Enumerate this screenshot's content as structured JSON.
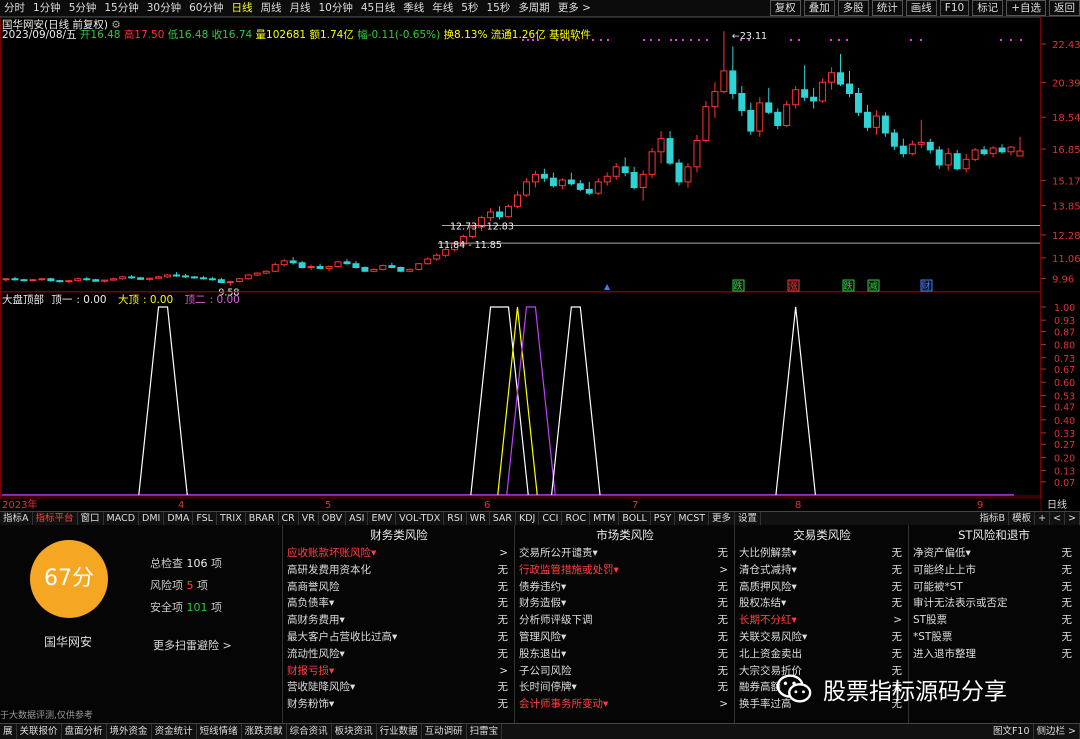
{
  "toolbar": {
    "periods": [
      "分时",
      "1分钟",
      "5分钟",
      "15分钟",
      "30分钟",
      "60分钟",
      "日线",
      "周线",
      "月线",
      "10分钟",
      "45日线",
      "季线",
      "年线",
      "5秒",
      "15秒",
      "多周期",
      "更多 >"
    ],
    "active_period": "日线",
    "right_tools": [
      "复权",
      "叠加",
      "多股",
      "统计",
      "画线",
      "F10",
      "标记",
      "+自选",
      "返回"
    ]
  },
  "quote": {
    "title": "国华网安(日线 前复权)",
    "date": "2023/09/08/五",
    "open_label": "开16.48",
    "high_label": "高17.50",
    "low_label": "低16.48",
    "close_label": "收16.74",
    "volume_label": "量102681",
    "amount_label": "额1.74亿",
    "change_label": "幅-0.11(-0.65%)",
    "turnover_label": "换8.13%",
    "float_label": "流通1.26亿",
    "software_label": "基础软件"
  },
  "chart_data": [
    {
      "type": "candlestick",
      "y_ticks": [
        22.43,
        20.39,
        18.54,
        16.85,
        15.17,
        13.85,
        12.28,
        11.06,
        9.96
      ],
      "annotations": {
        "peak": "23.11",
        "trough": "9.58",
        "zone1": "12.73 - 12.83",
        "zone2": "11.84 - 11.85"
      },
      "x_ticks": [
        "2023年",
        "4",
        "5",
        "6",
        "7",
        "8",
        "9"
      ],
      "candles": [
        [
          9.9,
          10.0,
          9.8,
          9.95
        ],
        [
          9.95,
          10.05,
          9.85,
          9.9
        ],
        [
          9.9,
          9.95,
          9.8,
          9.85
        ],
        [
          9.85,
          9.95,
          9.8,
          9.9
        ],
        [
          9.9,
          10.0,
          9.85,
          9.95
        ],
        [
          9.95,
          10.0,
          9.8,
          9.85
        ],
        [
          9.85,
          9.9,
          9.75,
          9.8
        ],
        [
          9.8,
          9.9,
          9.7,
          9.85
        ],
        [
          9.85,
          10.0,
          9.8,
          9.95
        ],
        [
          9.95,
          10.05,
          9.85,
          9.9
        ],
        [
          9.9,
          9.95,
          9.8,
          9.82
        ],
        [
          9.82,
          9.9,
          9.75,
          9.88
        ],
        [
          9.88,
          10.0,
          9.85,
          9.95
        ],
        [
          9.95,
          10.1,
          9.9,
          10.05
        ],
        [
          10.05,
          10.15,
          9.95,
          10.0
        ],
        [
          10.0,
          10.05,
          9.9,
          9.92
        ],
        [
          9.92,
          10.0,
          9.85,
          9.98
        ],
        [
          9.98,
          10.1,
          9.95,
          10.05
        ],
        [
          10.05,
          10.2,
          10.0,
          10.15
        ],
        [
          10.15,
          10.3,
          10.05,
          10.1
        ],
        [
          10.1,
          10.2,
          10.0,
          10.05
        ],
        [
          10.05,
          10.1,
          9.95,
          10.0
        ],
        [
          10.0,
          10.1,
          9.9,
          9.95
        ],
        [
          9.95,
          10.05,
          9.85,
          9.9
        ],
        [
          9.9,
          10.0,
          9.7,
          9.75
        ],
        [
          9.75,
          9.85,
          9.58,
          9.8
        ],
        [
          9.8,
          10.0,
          9.75,
          9.95
        ],
        [
          9.95,
          10.2,
          9.9,
          10.15
        ],
        [
          10.15,
          10.3,
          10.1,
          10.25
        ],
        [
          10.25,
          10.4,
          10.2,
          10.35
        ],
        [
          10.35,
          10.8,
          10.3,
          10.7
        ],
        [
          10.7,
          11.0,
          10.6,
          10.9
        ],
        [
          10.9,
          11.1,
          10.7,
          10.8
        ],
        [
          10.8,
          10.9,
          10.5,
          10.55
        ],
        [
          10.55,
          10.7,
          10.4,
          10.6
        ],
        [
          10.6,
          10.75,
          10.45,
          10.5
        ],
        [
          10.5,
          10.65,
          10.35,
          10.6
        ],
        [
          10.6,
          10.9,
          10.55,
          10.85
        ],
        [
          10.85,
          11.0,
          10.7,
          10.75
        ],
        [
          10.75,
          10.9,
          10.5,
          10.55
        ],
        [
          10.55,
          10.6,
          10.3,
          10.35
        ],
        [
          10.35,
          10.5,
          10.3,
          10.45
        ],
        [
          10.45,
          10.7,
          10.4,
          10.65
        ],
        [
          10.65,
          10.8,
          10.5,
          10.55
        ],
        [
          10.55,
          10.6,
          10.3,
          10.35
        ],
        [
          10.35,
          10.5,
          10.3,
          10.45
        ],
        [
          10.45,
          10.8,
          10.4,
          10.75
        ],
        [
          10.75,
          11.1,
          10.7,
          11.0
        ],
        [
          11.0,
          11.3,
          10.9,
          11.2
        ],
        [
          11.2,
          11.6,
          11.1,
          11.5
        ],
        [
          11.5,
          11.9,
          11.4,
          11.8
        ],
        [
          11.8,
          12.3,
          11.7,
          12.2
        ],
        [
          12.2,
          12.8,
          12.1,
          12.7
        ],
        [
          12.7,
          13.3,
          12.5,
          13.2
        ],
        [
          13.2,
          13.7,
          13.0,
          13.5
        ],
        [
          13.5,
          13.8,
          13.1,
          13.25
        ],
        [
          13.25,
          13.9,
          13.2,
          13.8
        ],
        [
          13.8,
          14.6,
          13.7,
          14.4
        ],
        [
          14.4,
          15.3,
          14.3,
          15.1
        ],
        [
          15.1,
          15.7,
          14.8,
          15.5
        ],
        [
          15.5,
          15.8,
          15.1,
          15.3
        ],
        [
          15.3,
          15.6,
          14.8,
          14.9
        ],
        [
          14.9,
          15.3,
          14.7,
          15.2
        ],
        [
          15.2,
          15.6,
          14.9,
          15.0
        ],
        [
          15.0,
          15.2,
          14.6,
          14.7
        ],
        [
          14.7,
          15.1,
          14.4,
          14.5
        ],
        [
          14.5,
          15.3,
          14.4,
          15.1
        ],
        [
          15.1,
          15.6,
          14.9,
          15.4
        ],
        [
          15.4,
          16.1,
          15.2,
          15.9
        ],
        [
          15.9,
          16.4,
          15.4,
          15.6
        ],
        [
          15.6,
          15.9,
          14.7,
          14.8
        ],
        [
          14.8,
          15.7,
          14.1,
          15.5
        ],
        [
          15.5,
          16.9,
          15.3,
          16.7
        ],
        [
          16.7,
          17.8,
          16.1,
          17.4
        ],
        [
          17.4,
          17.8,
          16.0,
          16.1
        ],
        [
          16.1,
          16.3,
          14.9,
          15.1
        ],
        [
          15.1,
          16.1,
          14.8,
          15.9
        ],
        [
          15.9,
          17.6,
          15.6,
          17.3
        ],
        [
          17.3,
          19.4,
          17.2,
          19.1
        ],
        [
          19.1,
          20.4,
          18.5,
          19.9
        ],
        [
          19.9,
          23.11,
          19.8,
          21.0
        ],
        [
          21.0,
          22.3,
          19.5,
          19.8
        ],
        [
          19.8,
          20.2,
          18.6,
          18.9
        ],
        [
          18.9,
          19.3,
          17.6,
          17.8
        ],
        [
          17.8,
          19.6,
          17.5,
          19.3
        ],
        [
          19.3,
          20.1,
          18.7,
          18.8
        ],
        [
          18.8,
          19.0,
          17.9,
          18.1
        ],
        [
          18.1,
          19.4,
          18.0,
          19.2
        ],
        [
          19.2,
          20.2,
          19.0,
          20.0
        ],
        [
          20.0,
          21.3,
          19.4,
          19.6
        ],
        [
          19.6,
          20.1,
          19.0,
          19.4
        ],
        [
          19.4,
          20.6,
          19.3,
          20.4
        ],
        [
          20.4,
          21.2,
          20.0,
          20.9
        ],
        [
          20.9,
          21.9,
          20.2,
          20.3
        ],
        [
          20.3,
          21.0,
          19.6,
          19.8
        ],
        [
          19.8,
          20.1,
          18.6,
          18.8
        ],
        [
          18.8,
          19.2,
          17.8,
          18.0
        ],
        [
          18.0,
          18.9,
          17.6,
          18.6
        ],
        [
          18.6,
          18.8,
          17.5,
          17.7
        ],
        [
          17.7,
          17.9,
          16.8,
          17.0
        ],
        [
          17.0,
          17.4,
          16.4,
          16.6
        ],
        [
          16.6,
          17.3,
          16.5,
          17.1
        ],
        [
          17.1,
          18.4,
          16.9,
          17.2
        ],
        [
          17.2,
          17.4,
          16.6,
          16.8
        ],
        [
          16.8,
          17.0,
          15.8,
          16.0
        ],
        [
          16.0,
          16.9,
          15.7,
          16.6
        ],
        [
          16.6,
          16.8,
          15.7,
          15.8
        ],
        [
          15.8,
          16.6,
          15.6,
          16.3
        ],
        [
          16.3,
          16.9,
          16.2,
          16.8
        ],
        [
          16.8,
          17.0,
          16.5,
          16.6
        ],
        [
          16.6,
          17.0,
          16.4,
          16.9
        ],
        [
          16.9,
          17.1,
          16.6,
          16.7
        ],
        [
          16.7,
          17.0,
          16.5,
          16.95
        ],
        [
          16.48,
          17.5,
          16.48,
          16.74
        ]
      ],
      "markers": [
        "跌",
        "涨",
        "跌",
        "减",
        "财"
      ]
    },
    {
      "type": "line",
      "title": "大盘顶部",
      "series_labels": [
        {
          "name": "顶一",
          "value": "0.00"
        },
        {
          "name": "大顶",
          "value": "0.00"
        },
        {
          "name": "顶二",
          "value": "0.00"
        }
      ],
      "y_ticks": [
        "1.00",
        "0.93",
        "0.87",
        "0.80",
        "0.73",
        "0.67",
        "0.60",
        "0.53",
        "0.47",
        "0.40",
        "0.33",
        "0.27",
        "0.20",
        "0.13",
        "0.07"
      ],
      "spikes": [
        {
          "color": "#ffffff",
          "at": [
            17,
            18
          ]
        },
        {
          "color": "#ffffff",
          "at": [
            54,
            56
          ]
        },
        {
          "color": "#ffff00",
          "at": [
            57
          ]
        },
        {
          "color": "#c040ff",
          "at": [
            58,
            59
          ]
        },
        {
          "color": "#ffffff",
          "at": [
            63,
            64
          ]
        },
        {
          "color": "#ffffff",
          "at": [
            88
          ]
        }
      ],
      "daykline_label": "日线"
    }
  ],
  "indicator_tabs": [
    "指标A",
    "指标平台",
    "窗口",
    "MACD",
    "DMI",
    "DMA",
    "FSL",
    "TRIX",
    "BRAR",
    "CR",
    "VR",
    "OBV",
    "ASI",
    "EMV",
    "VOL-TDX",
    "RSI",
    "WR",
    "SAR",
    "KDJ",
    "CCI",
    "ROC",
    "MTM",
    "BOLL",
    "PSY",
    "MCST",
    "更多",
    "设置"
  ],
  "indicator_tabs_right": [
    "指标B",
    "模板",
    "+",
    "<",
    ">"
  ],
  "risk": {
    "score": "67分",
    "stock": "国华网安",
    "stats": [
      {
        "label": "总检查",
        "value": "106",
        "unit": "项"
      },
      {
        "label": "风险项",
        "value": "5",
        "unit": "项"
      },
      {
        "label": "安全项",
        "value": "101",
        "unit": "项"
      }
    ],
    "more_scan": "更多扫雷避险 >",
    "disclaimer": "于大数据评测,仅供参考",
    "columns": [
      {
        "title": "财务类风险",
        "items": [
          {
            "label": "应收账款坏账风险▾",
            "status": ">",
            "hl": true
          },
          {
            "label": "高研发费用资本化",
            "status": "无"
          },
          {
            "label": "高商誉风险",
            "status": "无"
          },
          {
            "label": "高负债率▾",
            "status": "无"
          },
          {
            "label": "高财务费用▾",
            "status": "无"
          },
          {
            "label": "最大客户占营收比过高▾",
            "status": "无"
          },
          {
            "label": "流动性风险▾",
            "status": "无"
          },
          {
            "label": "财报亏损▾",
            "status": ">",
            "hl": true
          },
          {
            "label": "营收陡降风险▾",
            "status": "无"
          },
          {
            "label": "财务粉饰▾",
            "status": "无"
          }
        ]
      },
      {
        "title": "市场类风险",
        "items": [
          {
            "label": "交易所公开谴责▾",
            "status": "无"
          },
          {
            "label": "行政监管措施或处罚▾",
            "status": ">",
            "hl": true
          },
          {
            "label": "债券违约▾",
            "status": "无"
          },
          {
            "label": "财务造假▾",
            "status": "无"
          },
          {
            "label": "分析师评级下调",
            "status": "无"
          },
          {
            "label": "管理风险▾",
            "status": "无"
          },
          {
            "label": "股东退出▾",
            "status": "无"
          },
          {
            "label": "子公司风险",
            "status": "无"
          },
          {
            "label": "长时间停牌▾",
            "status": "无"
          },
          {
            "label": "会计师事务所变动▾",
            "status": ">",
            "hl": true
          }
        ]
      },
      {
        "title": "交易类风险",
        "items": [
          {
            "label": "大比例解禁▾",
            "status": "无"
          },
          {
            "label": "清仓式减持▾",
            "status": "无"
          },
          {
            "label": "高质押风险▾",
            "status": "无"
          },
          {
            "label": "股权冻结▾",
            "status": "无"
          },
          {
            "label": "长期不分红▾",
            "status": ">",
            "hl": true
          },
          {
            "label": "关联交易风险▾",
            "status": "无"
          },
          {
            "label": "北上资金卖出",
            "status": "无"
          },
          {
            "label": "大宗交易折价",
            "status": "无"
          },
          {
            "label": "融券高额",
            "status": "无"
          },
          {
            "label": "换手率过高",
            "status": "无"
          }
        ]
      },
      {
        "title": "ST风险和退市",
        "items": [
          {
            "label": "净资产偏低▾",
            "status": "无"
          },
          {
            "label": "可能终止上市",
            "status": "无"
          },
          {
            "label": "可能被*ST",
            "status": "无"
          },
          {
            "label": "审计无法表示或否定",
            "status": "无"
          },
          {
            "label": "ST股票",
            "status": "无"
          },
          {
            "label": "*ST股票",
            "status": "无"
          },
          {
            "label": "进入退市整理",
            "status": "无"
          }
        ]
      }
    ]
  },
  "bottom_bar": [
    "展",
    "关联报价",
    "盘面分析",
    "境外资金",
    "资金统计",
    "短线情绪",
    "涨跌贡献",
    "综合资讯",
    "板块资讯",
    "行业数据",
    "互动调研",
    "扫雷宝"
  ],
  "bottom_bar_right": [
    "图文F10",
    "侧边栏 >"
  ],
  "watermark": "股票指标源码分享",
  "colors": {
    "up": "#ff3333",
    "down": "#2fd3d3",
    "accent": "#ffff00",
    "score_bg": "#f5a623"
  }
}
